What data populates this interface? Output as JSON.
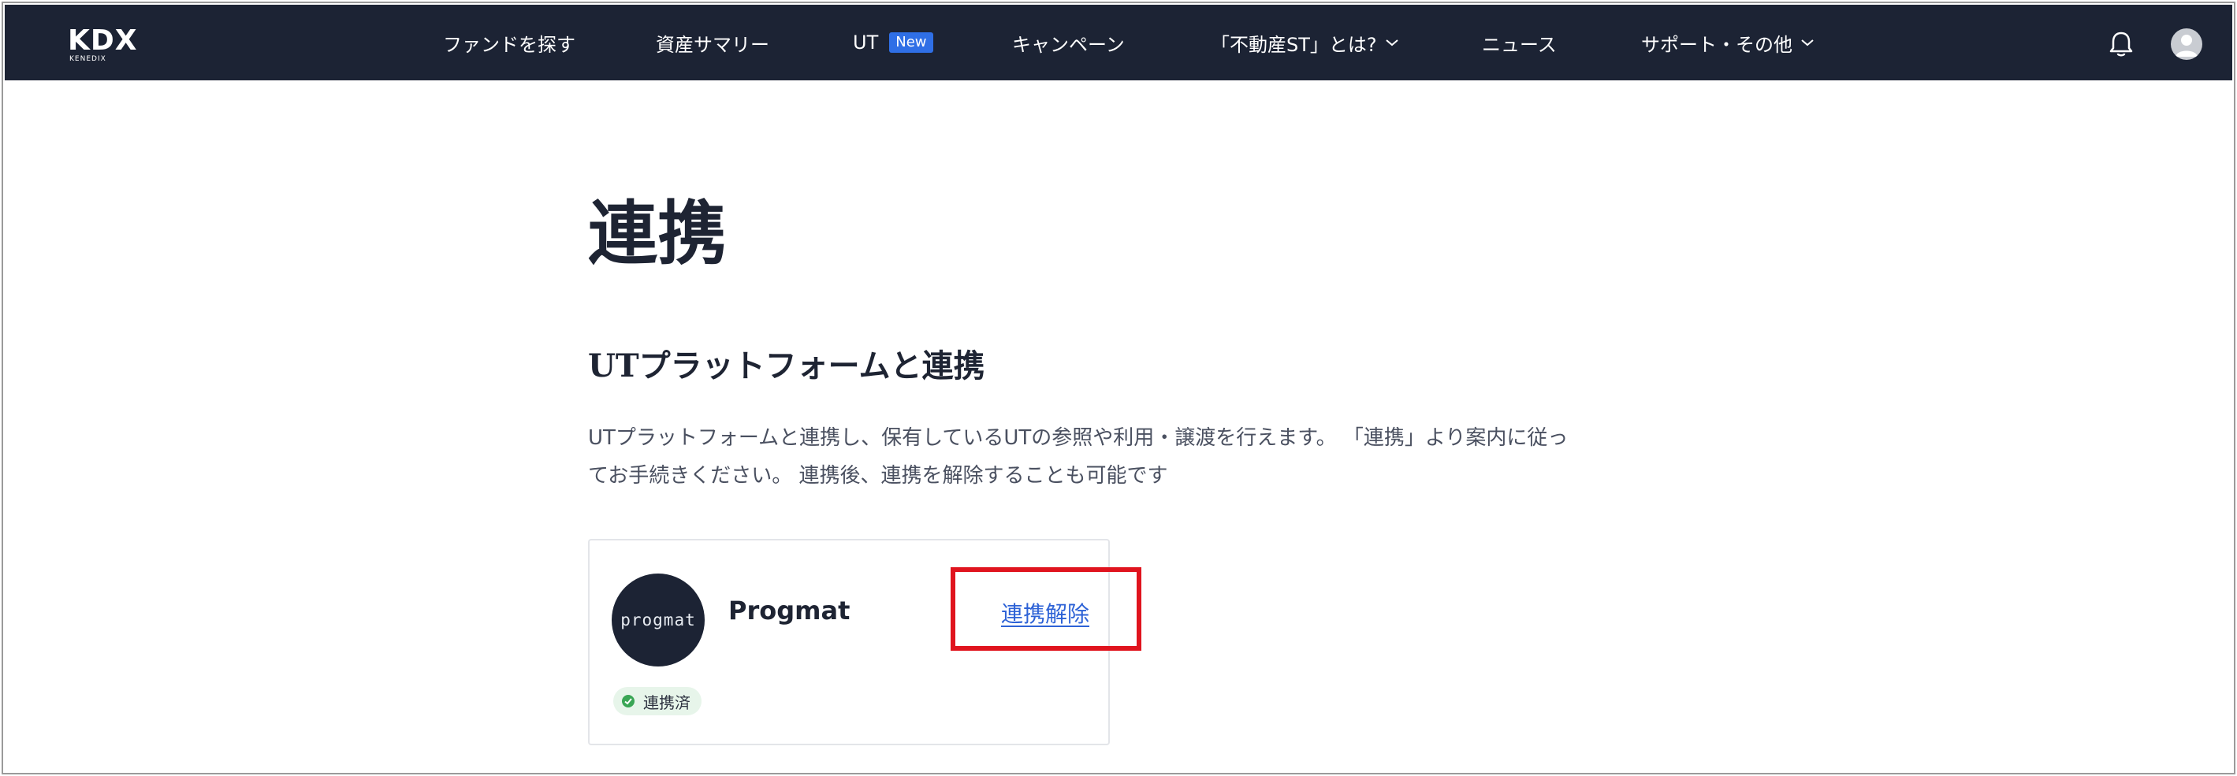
{
  "header": {
    "logo_text": "KDX",
    "logo_sub": "KENEDIX",
    "nav": [
      {
        "label": "ファンドを探す"
      },
      {
        "label": "資産サマリー"
      },
      {
        "label": "UT",
        "badge": "New"
      },
      {
        "label": "キャンペーン"
      },
      {
        "label": "「不動産ST」とは?"
      },
      {
        "label": "ニュース"
      },
      {
        "label": "サポート・その他"
      }
    ],
    "icons": {
      "notifications": "bell-icon",
      "account": "user-avatar-icon",
      "dropdown": "chevron-down-icon"
    },
    "colors": {
      "bg": "#1c2334",
      "badge": "#2f6fe6"
    }
  },
  "main": {
    "title": "連携",
    "section_title": "UTプラットフォームと連携",
    "description_line1": "UTプラットフォームと連携し、保有しているUTの参照や利用・譲渡を行えます。 「連携」より案内に従っ",
    "description_line2": "てお手続きください。 連携後、連携を解除することも可能です"
  },
  "card": {
    "logo_text": "progmat",
    "name": "Progmat",
    "action_label": "連携解除",
    "status_label": "連携済",
    "colors": {
      "link": "#2d62d6",
      "status_bg": "#e7f5ea",
      "status_icon": "#3aa655",
      "highlight": "#e0141e"
    }
  }
}
